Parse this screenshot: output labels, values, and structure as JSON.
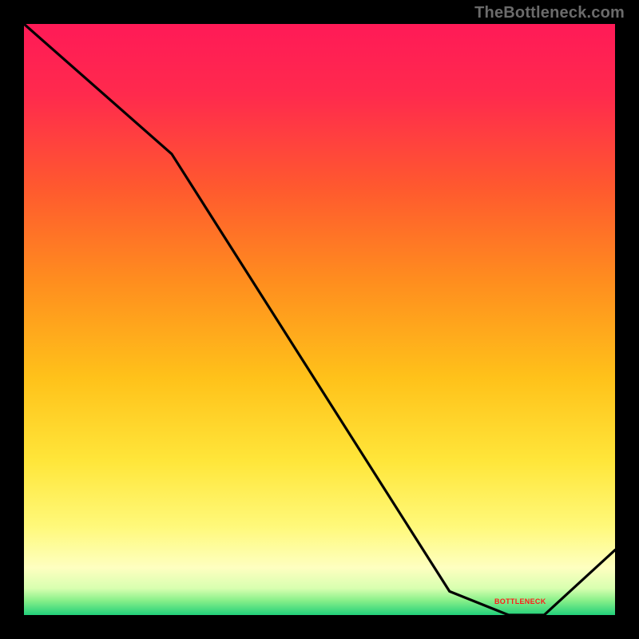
{
  "watermark": "TheBottleneck.com",
  "chart_data": {
    "type": "line",
    "title": "",
    "xlabel": "",
    "ylabel": "",
    "xlim": [
      0,
      100
    ],
    "ylim": [
      0,
      100
    ],
    "grid": false,
    "background": "red-yellow-green-vertical-gradient",
    "series": [
      {
        "name": "bottleneck-curve",
        "color": "#000000",
        "x": [
          0,
          25,
          72,
          82,
          88,
          100
        ],
        "values": [
          100,
          78,
          4,
          0,
          0,
          11
        ]
      }
    ],
    "annotations": [
      {
        "name": "valley-marker",
        "x": 85,
        "y": 2,
        "text": "BOTTLENECK"
      }
    ]
  }
}
